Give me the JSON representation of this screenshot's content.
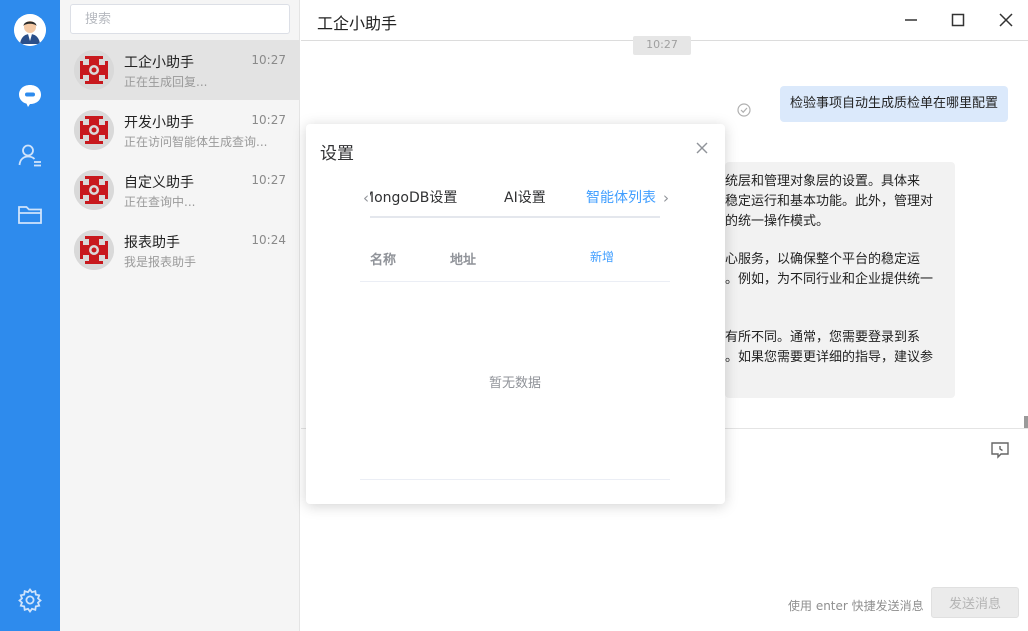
{
  "search": {
    "placeholder": "搜索"
  },
  "sessions": [
    {
      "name": "工企小助手",
      "time": "10:27",
      "preview": "正在生成回复..."
    },
    {
      "name": "开发小助手",
      "time": "10:27",
      "preview": "正在访问智能体生成查询..."
    },
    {
      "name": "自定义助手",
      "time": "10:27",
      "preview": "正在查询中..."
    },
    {
      "name": "报表助手",
      "time": "10:24",
      "preview": "我是报表助手"
    }
  ],
  "chat": {
    "title": "工企小助手",
    "timestamp": "10:27",
    "user_message": "检验事项自动生成质检单在哪里配置",
    "bot_lines": [
      "统层和管理对象层的设置。具体来",
      "稳定运行和基本功能。此外，管理对",
      "的统一操作模式。",
      "心服务，以确保整个平台的稳定运",
      "。例如，为不同行业和企业提供统一",
      "有所不同。通常，您需要登录到系",
      "。如果您需要更详细的指导，建议参"
    ],
    "input_hint": "使用 enter 快捷发送消息",
    "send_label": "发送消息"
  },
  "dialog": {
    "title": "设置",
    "tabs": [
      "MongoDB设置",
      "AI设置",
      "智能体列表"
    ],
    "active_tab": "智能体列表",
    "columns": {
      "name": "名称",
      "address": "地址"
    },
    "add_label": "新增",
    "empty_text": "暂无数据"
  },
  "colors": {
    "rail": "#2e8bed",
    "accent": "#409eff",
    "logo_red": "#c8191e",
    "user_bubble": "#dbe9fb"
  },
  "icons": {
    "rail": [
      "user-avatar-icon",
      "chat-bubble-icon",
      "contacts-icon",
      "folder-icon",
      "settings-gear-icon"
    ],
    "window": [
      "minimize-icon",
      "maximize-icon",
      "close-icon"
    ]
  }
}
